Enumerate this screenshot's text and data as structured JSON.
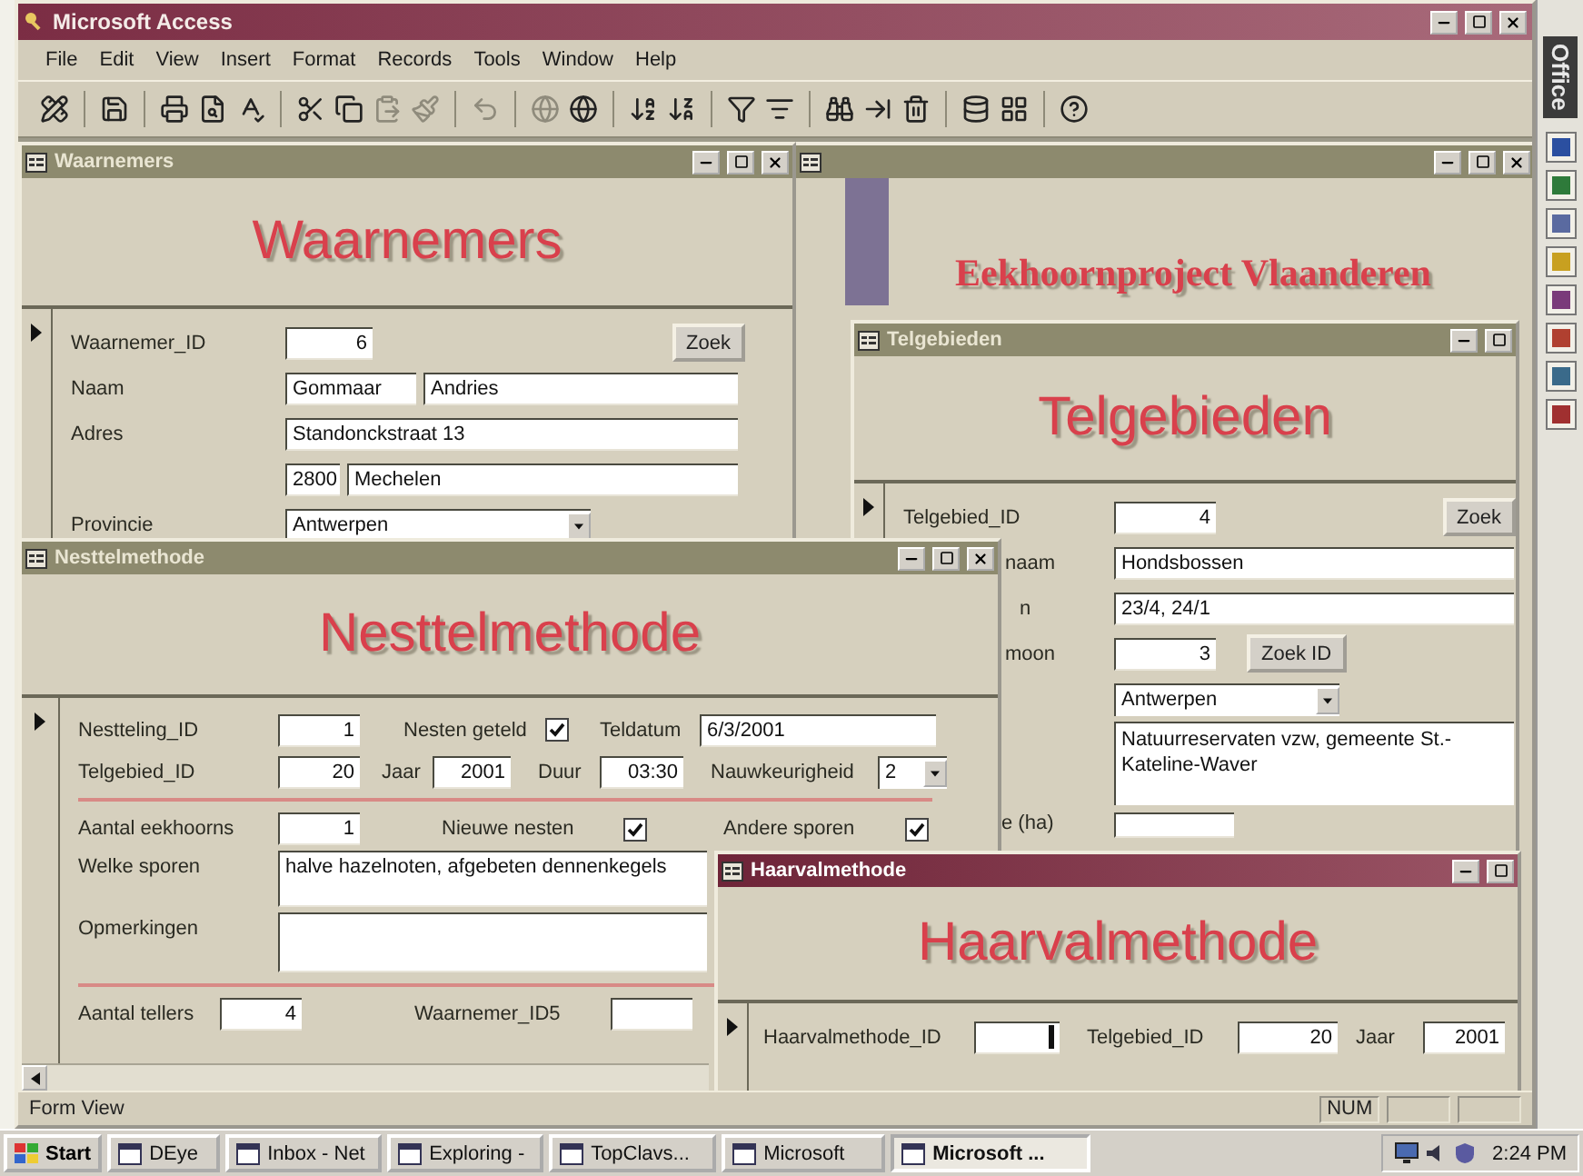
{
  "app": {
    "title": "Microsoft Access",
    "menu": [
      "File",
      "Edit",
      "View",
      "Insert",
      "Format",
      "Records",
      "Tools",
      "Window",
      "Help"
    ],
    "status": "Form View",
    "indicator": "NUM"
  },
  "office_bar": {
    "label": "Office"
  },
  "waarnemers": {
    "title": "Waarnemers",
    "active": false,
    "heading": "Waarnemers",
    "id": {
      "label": "Waarnemer_ID",
      "value": "6"
    },
    "zoek": "Zoek",
    "naam": {
      "label": "Naam",
      "first": "Gommaar",
      "last": "Andries"
    },
    "adres": {
      "label": "Adres",
      "street": "Standonckstraat 13",
      "postcode": "2800",
      "city": "Mechelen"
    },
    "provincie": {
      "label": "Provincie",
      "value": "Antwerpen"
    }
  },
  "project": {
    "active": false,
    "heading": "Eekhoornproject Vlaanderen"
  },
  "telgebieden": {
    "title": "Telgebieden",
    "active": false,
    "heading": "Telgebieden",
    "id": {
      "label": "Telgebied_ID",
      "value": "4"
    },
    "zoek": "Zoek",
    "naam": {
      "label": "naam",
      "value": "Hondsbossen"
    },
    "data": {
      "label": "n",
      "value": "23/4, 24/1"
    },
    "contact": {
      "label": "moon",
      "value": "3",
      "button": "Zoek ID"
    },
    "provincie": "Antwerpen",
    "beheer": "Natuurreservaten vzw, gemeente St.-Kateline-Waver",
    "oppervlakte": {
      "label": "e (ha)"
    }
  },
  "nesttel": {
    "title": "Nesttelmethode",
    "active": false,
    "heading": "Nesttelmethode",
    "id": {
      "label": "Nestteling_ID",
      "value": "1"
    },
    "nesten_geteld": {
      "label": "Nesten geteld",
      "checked": true
    },
    "teldatum": {
      "label": "Teldatum",
      "value": "6/3/2001"
    },
    "telgebied": {
      "label": "Telgebied_ID",
      "value": "20"
    },
    "jaar": {
      "label": "Jaar",
      "value": "2001"
    },
    "duur": {
      "label": "Duur",
      "value": "03:30"
    },
    "nauwkeurigheid": {
      "label": "Nauwkeurigheid",
      "value": "2"
    },
    "aantal": {
      "label": "Aantal eekhoorns",
      "value": "1"
    },
    "nieuwe": {
      "label": "Nieuwe nesten",
      "checked": true
    },
    "andere": {
      "label": "Andere sporen",
      "checked": true
    },
    "sporen": {
      "label": "Welke sporen",
      "value": "halve hazelnoten, afgebeten dennenkegels"
    },
    "opmerkingen": {
      "label": "Opmerkingen"
    },
    "tellers": {
      "label": "Aantal tellers",
      "value": "4"
    },
    "waarnemer5": {
      "label": "Waarnemer_ID5"
    }
  },
  "haarval": {
    "title": "Haarvalmethode",
    "active": true,
    "heading": "Haarvalmethode",
    "id": {
      "label": "Haarvalmethode_ID"
    },
    "telgebied": {
      "label": "Telgebied_ID",
      "value": "20"
    },
    "jaar": {
      "label": "Jaar",
      "value": "2001"
    }
  },
  "taskbar": {
    "start": "Start",
    "items": [
      {
        "label": "DEye",
        "selected": false
      },
      {
        "label": "Inbox - Net",
        "selected": false
      },
      {
        "label": "Exploring -",
        "selected": false
      },
      {
        "label": "TopClavs...",
        "selected": false
      },
      {
        "label": "Microsoft",
        "selected": false
      },
      {
        "label": "Microsoft ...",
        "selected": true
      }
    ],
    "clock": "2:24 PM"
  }
}
